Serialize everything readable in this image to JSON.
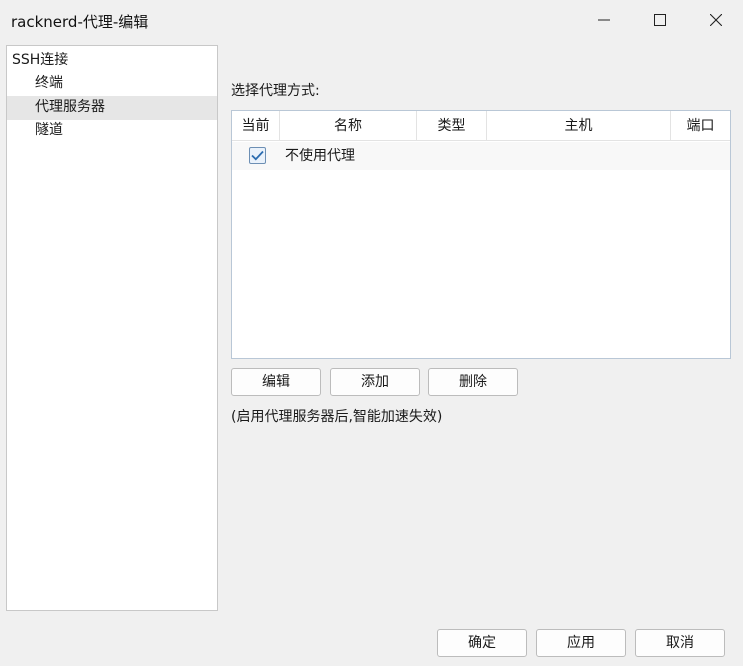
{
  "window": {
    "title": "racknerd-代理-编辑",
    "controls": [
      "minimize-icon",
      "maximize-icon",
      "close-icon"
    ]
  },
  "tree": {
    "root": "SSH连接",
    "children": [
      {
        "label": "终端",
        "selected": false
      },
      {
        "label": "代理服务器",
        "selected": true
      },
      {
        "label": "隧道",
        "selected": false
      }
    ]
  },
  "main": {
    "section_label": "选择代理方式:",
    "table": {
      "columns": [
        "当前",
        "名称",
        "类型",
        "主机",
        "端口"
      ],
      "rows": [
        {
          "current": true,
          "name": "不使用代理",
          "type": "",
          "host": "",
          "port": ""
        }
      ]
    },
    "buttons": {
      "edit": "编辑",
      "add": "添加",
      "delete": "删除"
    },
    "note": "(启用代理服务器后,智能加速失效)"
  },
  "footer": {
    "ok": "确定",
    "apply": "应用",
    "cancel": "取消"
  },
  "colors": {
    "background": "#f0f0f0",
    "checkbox_check": "#2b6cb0",
    "table_border": "#b9c7d6"
  }
}
